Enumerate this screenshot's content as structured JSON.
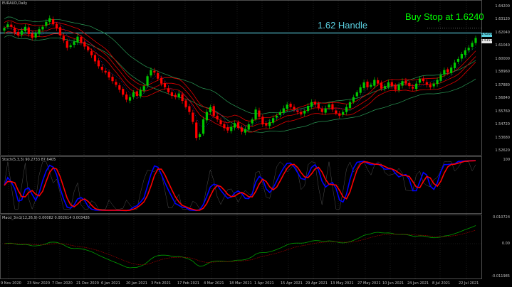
{
  "chart_title": "EURAUD,Daily",
  "stoch_label": "Stoch(5,3,3) 90.2733 87.6405",
  "macd_label": "Macd_3in1(12,26,9) 0.00082 0.002614 0.003426",
  "annotations": {
    "handle": "1.62 Handle",
    "buy_stop": "Buy Stop at 1.6240"
  },
  "colors": {
    "background": "#000000",
    "bull_candle": "#00c800",
    "bear_candle": "#ff0000",
    "handle_line": "#5ad0e0",
    "annotation_green": "#00ff00",
    "stoch_main": "#0000ff",
    "stoch_signal": "#ff0000",
    "macd_main": "#00a000",
    "macd_signal": "#a00000"
  },
  "price_axis": [
    "1.64200",
    "1.63120",
    "1.62040",
    "1.61040",
    "1.60000",
    "1.58960",
    "1.57880",
    "1.56840",
    "1.55760",
    "1.54720",
    "1.53680",
    "1.52620"
  ],
  "price_boxes": {
    "handle": "1.62000",
    "current": "1.61511"
  },
  "stoch_axis": [
    "100"
  ],
  "macd_axis": [
    "0.010724",
    "0.00",
    "-0.011985"
  ],
  "date_axis": [
    "9 Nov 2020",
    "23 Nov 2020",
    "7 Dec 2020",
    "21 Dec 2020",
    "6 Jan 2021",
    "20 Jan 2021",
    "3 Feb 2021",
    "17 Feb 2021",
    "4 Mar 2021",
    "18 Mar 2021",
    "1 Apr 2021",
    "15 Apr 2021",
    "29 Apr 2021",
    "13 May 2021",
    "27 May 2021",
    "10 Jun 2021",
    "24 Jun 2021",
    "8 Jul 2021",
    "22 Jul 2021"
  ],
  "chart_data": {
    "type": "candlestick",
    "symbol": "EURAUD",
    "timeframe": "Daily",
    "ylim": [
      1.523,
      1.645
    ],
    "horizontal_lines": [
      1.62
    ],
    "closes": [
      1.624,
      1.627,
      1.625,
      1.6205,
      1.618,
      1.622,
      1.625,
      1.619,
      1.616,
      1.62,
      1.623,
      1.625,
      1.629,
      1.632,
      1.627,
      1.624,
      1.618,
      1.614,
      1.608,
      1.61,
      1.613,
      1.617,
      1.612,
      1.609,
      1.606,
      1.602,
      1.597,
      1.593,
      1.59,
      1.588,
      1.584,
      1.581,
      1.578,
      1.574,
      1.57,
      1.566,
      1.568,
      1.572,
      1.569,
      1.574,
      1.577,
      1.585,
      1.59,
      1.588,
      1.583,
      1.579,
      1.576,
      1.572,
      1.569,
      1.568,
      1.571,
      1.565,
      1.56,
      1.556,
      1.548,
      1.535,
      1.538,
      1.55,
      1.556,
      1.56,
      1.553,
      1.55,
      1.546,
      1.543,
      1.541,
      1.544,
      1.547,
      1.543,
      1.54,
      1.542,
      1.546,
      1.55,
      1.558,
      1.552,
      1.546,
      1.545,
      1.548,
      1.551,
      1.553,
      1.556,
      1.559,
      1.562,
      1.56,
      1.558,
      1.556,
      1.554,
      1.557,
      1.561,
      1.564,
      1.562,
      1.559,
      1.556,
      1.559,
      1.562,
      1.558,
      1.555,
      1.553,
      1.556,
      1.56,
      1.564,
      1.568,
      1.572,
      1.576,
      1.58,
      1.576,
      1.578,
      1.582,
      1.579,
      1.575,
      1.577,
      1.58,
      1.577,
      1.574,
      1.578,
      1.581,
      1.579,
      1.577,
      1.575,
      1.579,
      1.583,
      1.581,
      1.578,
      1.576,
      1.579,
      1.582,
      1.586,
      1.59,
      1.588,
      1.592,
      1.596,
      1.599,
      1.603,
      1.606,
      1.608,
      1.612,
      1.616
    ]
  }
}
